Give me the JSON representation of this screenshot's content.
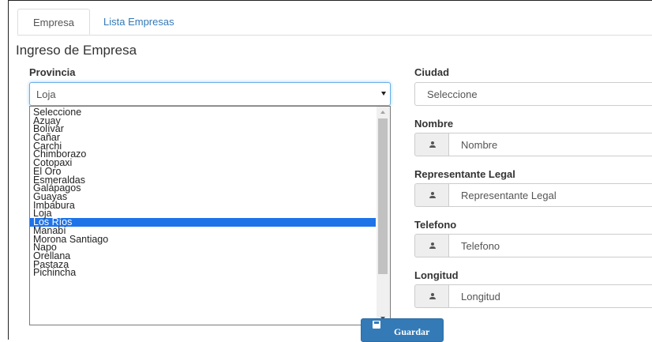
{
  "tabs": [
    {
      "label": "Empresa",
      "active": true
    },
    {
      "label": "Lista Empresas",
      "active": false
    }
  ],
  "title": "Ingreso de Empresa",
  "provincia": {
    "label": "Provincia",
    "value": "Loja",
    "options": [
      "Seleccione",
      "Azuay",
      "Bolívar",
      "Cañar",
      "Carchi",
      "Chimborazo",
      "Cotopaxi",
      "El Oro",
      "Esmeraldas",
      "Galápagos",
      "Guayas",
      "Imbabura",
      "Loja",
      "Los Ríos",
      "Manabí",
      "Morona Santiago",
      "Napo",
      "Orellana",
      "Pastaza",
      "Pichincha"
    ],
    "highlighted": "Los Ríos"
  },
  "ciudad": {
    "label": "Ciudad",
    "value": "Seleccione"
  },
  "fields": [
    {
      "label": "Nombre",
      "placeholder": "Nombre"
    },
    {
      "label": "Representante Legal",
      "placeholder": "Representante Legal"
    },
    {
      "label": "Telefono",
      "placeholder": "Telefono"
    },
    {
      "label": "Longitud",
      "placeholder": "Longitud"
    }
  ],
  "icons": {
    "field_addon": "user-icon",
    "save": "floppy-disk-icon"
  },
  "buttons": {
    "save_label": "Guardar"
  },
  "colors": {
    "accent": "#337ab7",
    "highlight": "#1e73e8"
  }
}
